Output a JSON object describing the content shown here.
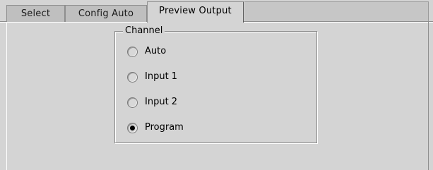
{
  "tabs": [
    {
      "label": "Select",
      "active": false
    },
    {
      "label": "Config Auto",
      "active": false
    },
    {
      "label": "Preview Output",
      "active": true
    }
  ],
  "channel": {
    "legend": "Channel",
    "options": [
      {
        "label": "Auto",
        "checked": false
      },
      {
        "label": "Input 1",
        "checked": false
      },
      {
        "label": "Input 2",
        "checked": false
      },
      {
        "label": "Program",
        "checked": true
      }
    ]
  },
  "colors": {
    "background": "#d4d4d4",
    "tab_inactive": "#bfbfbf",
    "border": "#8e8e8e",
    "radio_dot": "#000000"
  },
  "icons": {
    "radio_unchecked": "radio-unchecked-icon",
    "radio_checked": "radio-checked-icon"
  }
}
